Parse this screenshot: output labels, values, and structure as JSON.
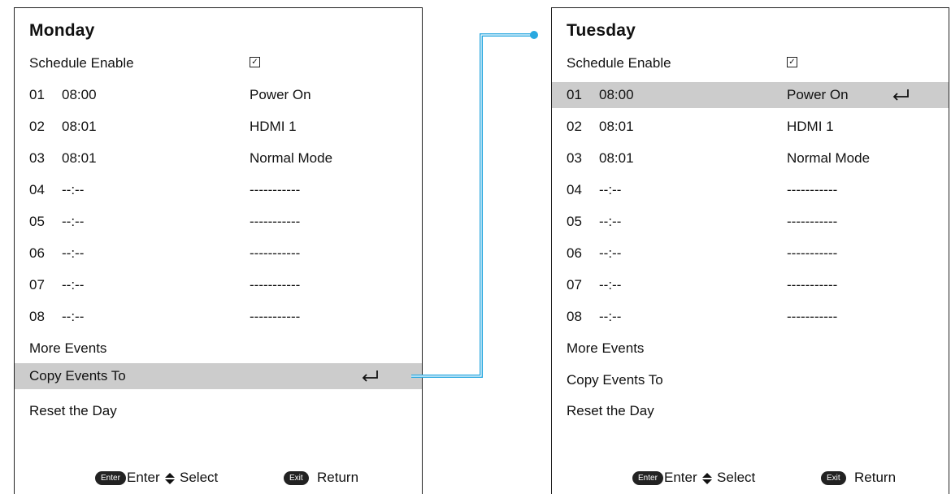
{
  "colors": {
    "selected_row": "#cccccc",
    "connector": "#29a8e0",
    "border": "#222222"
  },
  "left_panel": {
    "title": "Monday",
    "schedule_enable_label": "Schedule Enable",
    "schedule_enabled": true,
    "events": [
      {
        "num": "01",
        "time": "08:00",
        "action": "Power On"
      },
      {
        "num": "02",
        "time": "08:01",
        "action": "HDMI 1"
      },
      {
        "num": "03",
        "time": "08:01",
        "action": "Normal Mode"
      },
      {
        "num": "04",
        "time": "--:--",
        "action": "-----------"
      },
      {
        "num": "05",
        "time": "--:--",
        "action": "-----------"
      },
      {
        "num": "06",
        "time": "--:--",
        "action": "-----------"
      },
      {
        "num": "07",
        "time": "--:--",
        "action": "-----------"
      },
      {
        "num": "08",
        "time": "--:--",
        "action": "-----------"
      }
    ],
    "more_events": "More Events",
    "copy_events": "Copy Events To",
    "reset_day": "Reset the Day",
    "footer": {
      "enter_key": "Enter",
      "enter_label": "Enter",
      "select_label": "Select",
      "exit_key": "Exit",
      "return_label": "Return"
    }
  },
  "right_panel": {
    "title": "Tuesday",
    "schedule_enable_label": "Schedule Enable",
    "schedule_enabled": true,
    "events": [
      {
        "num": "01",
        "time": "08:00",
        "action": "Power On"
      },
      {
        "num": "02",
        "time": "08:01",
        "action": "HDMI 1"
      },
      {
        "num": "03",
        "time": "08:01",
        "action": "Normal Mode"
      },
      {
        "num": "04",
        "time": "--:--",
        "action": "-----------"
      },
      {
        "num": "05",
        "time": "--:--",
        "action": "-----------"
      },
      {
        "num": "06",
        "time": "--:--",
        "action": "-----------"
      },
      {
        "num": "07",
        "time": "--:--",
        "action": "-----------"
      },
      {
        "num": "08",
        "time": "--:--",
        "action": "-----------"
      }
    ],
    "more_events": "More Events",
    "copy_events": "Copy Events To",
    "reset_day": "Reset the Day",
    "footer": {
      "enter_key": "Enter",
      "enter_label": "Enter",
      "select_label": "Select",
      "exit_key": "Exit",
      "return_label": "Return"
    }
  }
}
